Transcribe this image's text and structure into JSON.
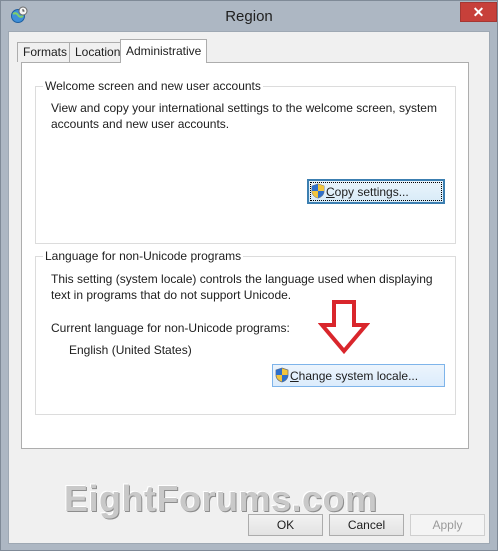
{
  "window": {
    "title": "Region",
    "close_label": "✕"
  },
  "tabs": [
    {
      "label": "Formats",
      "active": false
    },
    {
      "label": "Location",
      "active": false
    },
    {
      "label": "Administrative",
      "active": true
    }
  ],
  "welcome_group": {
    "label": "Welcome screen and new user accounts",
    "description_line1": "View and copy your international settings to the welcome screen, system",
    "description_line2": "accounts and new user accounts.",
    "copy_button_mnemonic": "C",
    "copy_button_rest": "opy settings..."
  },
  "locale_group": {
    "label": "Language for non-Unicode programs",
    "description_line1": "This setting (system locale) controls the language used when displaying",
    "description_line2": "text in programs that do not support Unicode.",
    "current_label": "Current language for non-Unicode programs:",
    "current_value": "English (United States)",
    "change_button_mnemonic": "C",
    "change_button_rest": "hange system locale..."
  },
  "footer": {
    "ok_label": "OK",
    "cancel_label": "Cancel",
    "apply_label": "Apply"
  },
  "watermark": "EightForums.com",
  "colors": {
    "frame": "#adb7c3",
    "close": "#c7403a",
    "annotation_arrow": "#d9262c"
  },
  "icons": {
    "app": "globe-clock-icon",
    "uac": "uac-shield-icon",
    "annotation": "down-arrow-icon"
  }
}
